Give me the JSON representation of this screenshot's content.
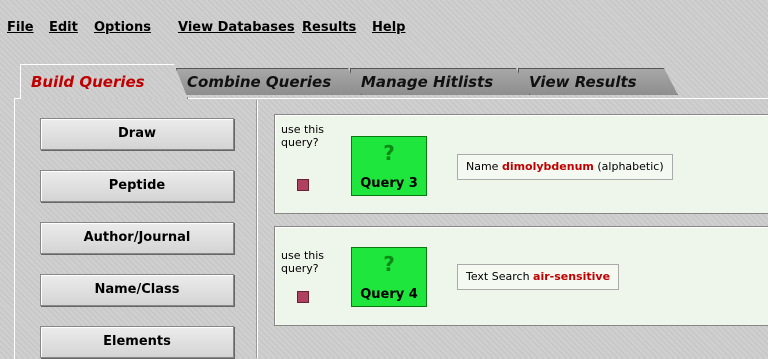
{
  "menu": [
    "File",
    "Edit",
    "Options",
    "View Databases",
    "Results",
    "Help"
  ],
  "tabs": [
    "Build Queries",
    "Combine Queries",
    "Manage Hitlists",
    "View Results"
  ],
  "left_buttons": [
    "Draw",
    "Peptide",
    "Author/Journal",
    "Name/Class",
    "Elements"
  ],
  "queries": [
    {
      "use_label": "use this query?",
      "mark": "?",
      "label": "Query 3",
      "prefix": "Name ",
      "term": "dimolybdenum",
      "suffix": " (alphabetic)"
    },
    {
      "use_label": "use this query?",
      "mark": "?",
      "label": "Query 4",
      "prefix": "Text Search ",
      "term": "air-sensitive",
      "suffix": ""
    }
  ],
  "colors": {
    "active_tab": "#c00000",
    "query_box": "#1ee63c",
    "checkbox": "#b04060",
    "highlight_term": "#c00000"
  }
}
